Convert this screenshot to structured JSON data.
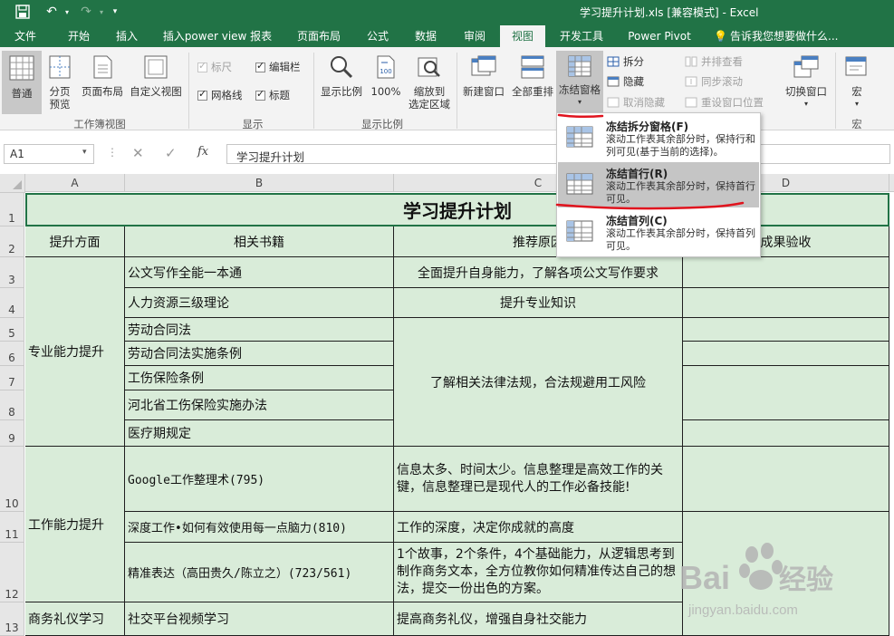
{
  "title_bar": {
    "title": "学习提升计划.xls  [兼容模式] - Excel"
  },
  "tabs": [
    "文件",
    "开始",
    "插入",
    "插入power view 报表",
    "页面布局",
    "公式",
    "数据",
    "审阅",
    "视图",
    "开发工具",
    "Power Pivot",
    "告诉我您想要做什么..."
  ],
  "ribbon": {
    "workbook_views": {
      "label": "工作簿视图",
      "normal": "普通",
      "page_break_1": "分页",
      "page_break_2": "预览",
      "page_layout": "页面布局",
      "custom_views": "自定义视图"
    },
    "show": {
      "label": "显示",
      "ruler": "标尺",
      "formula_bar": "编辑栏",
      "gridlines": "网格线",
      "headings": "标题"
    },
    "zoom": {
      "label": "显示比例",
      "zoom": "显示比例",
      "zoom100": "100%",
      "zoom_sel_1": "缩放到",
      "zoom_sel_2": "选定区域"
    },
    "window": {
      "new_window": "新建窗口",
      "arrange_all": "全部重排",
      "freeze_panes": "冻结窗格",
      "split": "拆分",
      "hide": "隐藏",
      "unhide": "取消隐藏",
      "side_by_side": "并排查看",
      "sync_scroll": "同步滚动",
      "reset_pos": "重设窗口位置",
      "switch_windows": "切换窗口"
    },
    "macros": {
      "label": "宏",
      "macros": "宏"
    }
  },
  "formula_bar": {
    "name_box": "A1",
    "fx": "fx",
    "content": "学习提升计划"
  },
  "columns": [
    "A",
    "B",
    "C",
    "D"
  ],
  "rows": [
    "1",
    "2",
    "3",
    "4",
    "5",
    "6",
    "7",
    "8",
    "9",
    "10",
    "11",
    "12",
    "13"
  ],
  "sheet": {
    "title": "学习提升计划",
    "headers": [
      "提升方面",
      "相关书籍",
      "推荐原因",
      "成果验收"
    ],
    "cat1": "专业能力提升",
    "cat2": "工作能力提升",
    "cat3": "商务礼仪学习",
    "b3": "公文写作全能一本通",
    "b4": "人力资源三级理论",
    "b5": "劳动合同法",
    "b6": "劳动合同法实施条例",
    "b7": "工伤保险条例",
    "b8": "河北省工伤保险实施办法",
    "b9": "医疗期规定",
    "b10": "Google工作整理术(795)",
    "b11": "深度工作•如何有效使用每一点脑力(810)",
    "b12": "精准表达（高田贵久/陈立之）(723/561)",
    "b13": "社交平台视频学习",
    "c3": "全面提升自身能力，了解各项公文写作要求",
    "c4": "提升专业知识",
    "c5": "了解相关法律法规，合法规避用工风险",
    "c10": "信息太多、时间太少。信息整理是高效工作的关键，信息整理已是现代人的工作必备技能!",
    "c11": "工作的深度，决定你成就的高度",
    "c12": "1个故事，2个条件，4个基础能力，从逻辑思考到制作商务文本，全方位教你如何精准传达自己的想法，提交一份出色的方案。",
    "c13": "提高商务礼仪，增强自身社交能力"
  },
  "freeze_menu": {
    "items": [
      {
        "title": "冻结拆分窗格(F)",
        "desc": "滚动工作表其余部分时，保持行和列可见(基于当前的选择)。"
      },
      {
        "title": "冻结首行(R)",
        "desc": "滚动工作表其余部分时，保持首行可见。"
      },
      {
        "title": "冻结首列(C)",
        "desc": "滚动工作表其余部分时，保持首列可见。"
      }
    ]
  },
  "watermark": {
    "brand": "Bai du 经验",
    "url": "jingyan.baidu.com"
  },
  "colors": {
    "excel_green": "#217346",
    "cell_fill": "#d9ecd9",
    "annotation_red": "#e0141e"
  }
}
